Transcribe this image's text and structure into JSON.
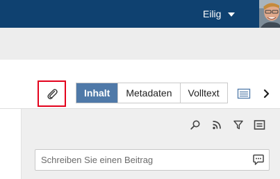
{
  "header": {
    "user_name": "Eilig",
    "icons": {
      "dropdown": "caret-down-icon",
      "avatar": "user-avatar-photo"
    },
    "colors": {
      "bar": "#0f4170",
      "strip": "#ededed"
    }
  },
  "toolbar": {
    "attach_icon": "paperclip-icon",
    "attach_highlight_color": "#e3001b",
    "tabs": [
      {
        "label": "Inhalt",
        "active": true
      },
      {
        "label": "Metadaten",
        "active": false
      },
      {
        "label": "Volltext",
        "active": false
      }
    ],
    "active_tab_color": "#4f79a8",
    "list_view_icon": "list-view-icon",
    "next_icon": "chevron-right-icon"
  },
  "panel": {
    "tools": [
      "search-icon",
      "rss-feed-icon",
      "filter-icon",
      "comment-list-icon"
    ],
    "post_placeholder": "Schreiben Sie einen Beitrag",
    "post_value": "",
    "post_icon": "speech-bubble-icon",
    "background": "#efefef"
  }
}
